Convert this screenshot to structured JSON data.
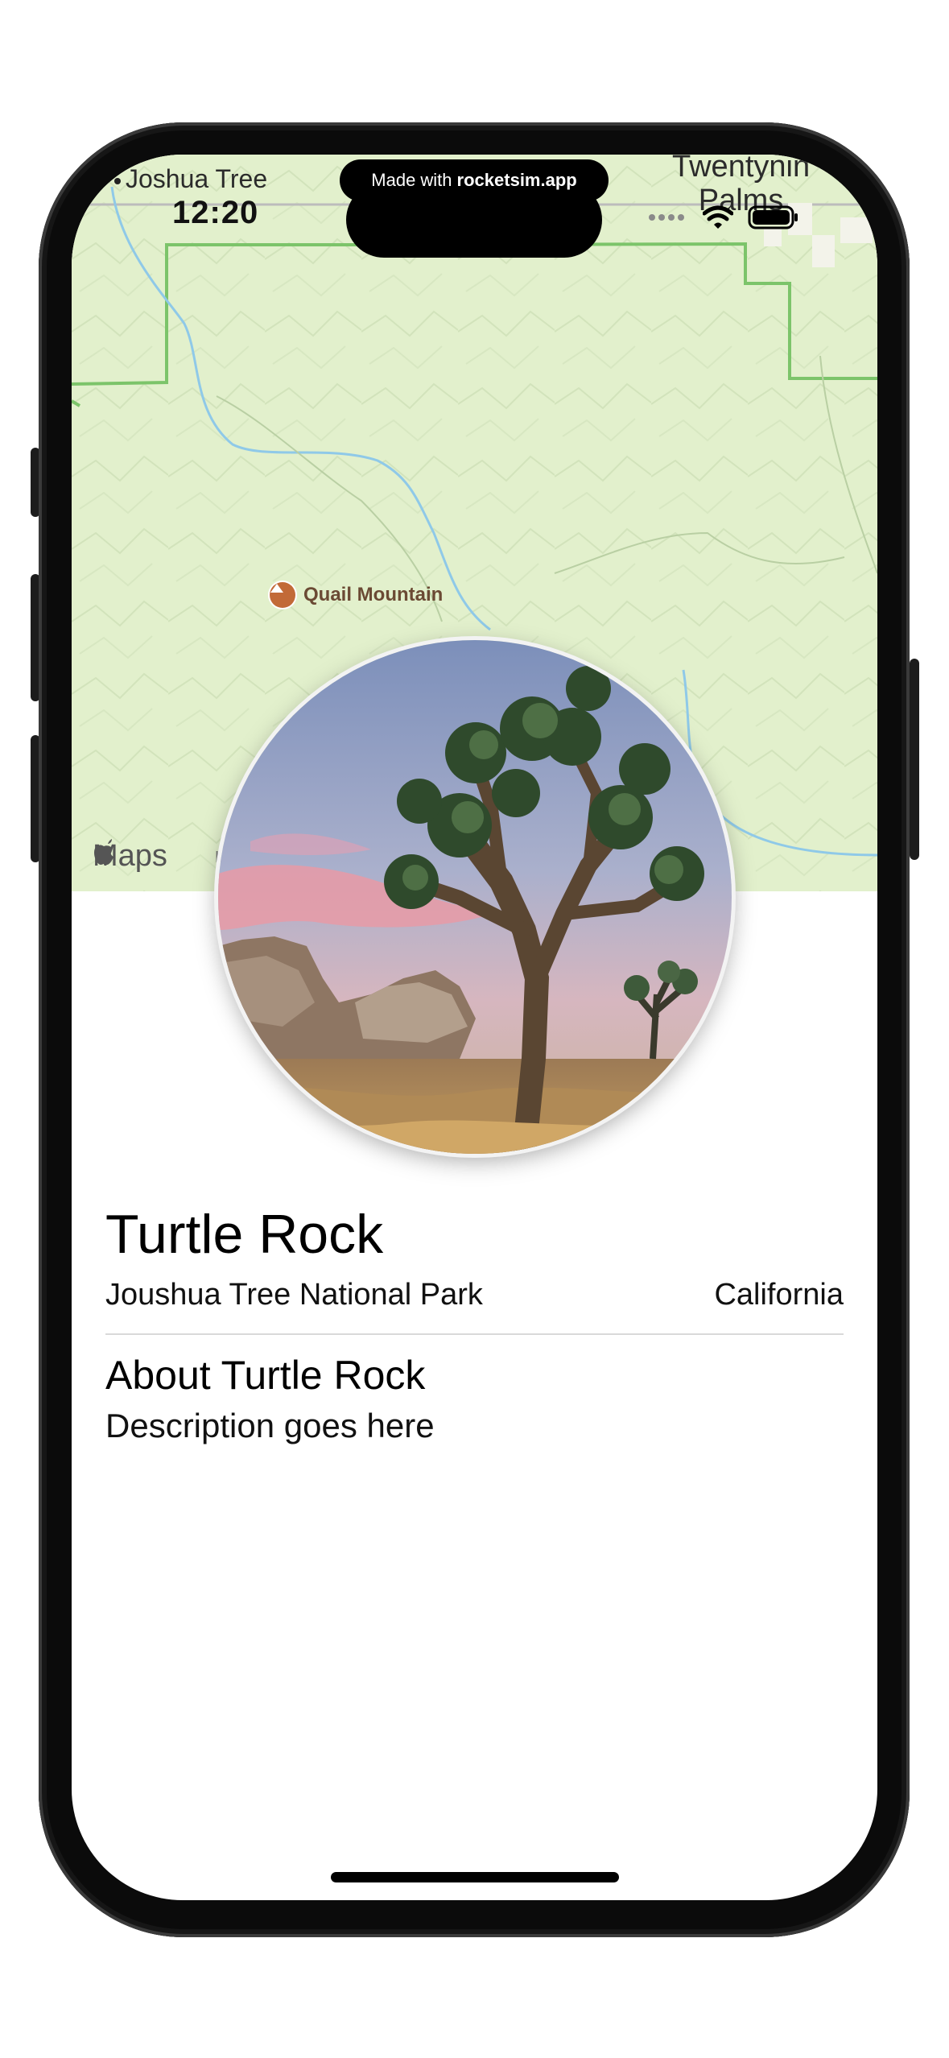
{
  "status_bar": {
    "time": "12:20",
    "banner_prefix": "Made with",
    "banner_brand": "rocketsim.app"
  },
  "map": {
    "label_top_left": "Joshua Tree",
    "label_top_right": "Twentynin\nPalms",
    "poi_label": "Quail Mountain",
    "maps_logo_text": "Maps",
    "legal_text": "L",
    "colors": {
      "land": "#e2f0cc",
      "park_border": "#7cc46a",
      "water": "#8fc9e8",
      "poi": "#c26a37"
    }
  },
  "landmark": {
    "name": "Turtle Rock",
    "park": "Joushua Tree National Park",
    "state": "California",
    "about_heading": "About Turtle Rock",
    "description": "Description goes here"
  },
  "icons": [
    "apple-logo-icon",
    "mountain-icon",
    "wifi-icon",
    "battery-icon",
    "signal-icon"
  ]
}
